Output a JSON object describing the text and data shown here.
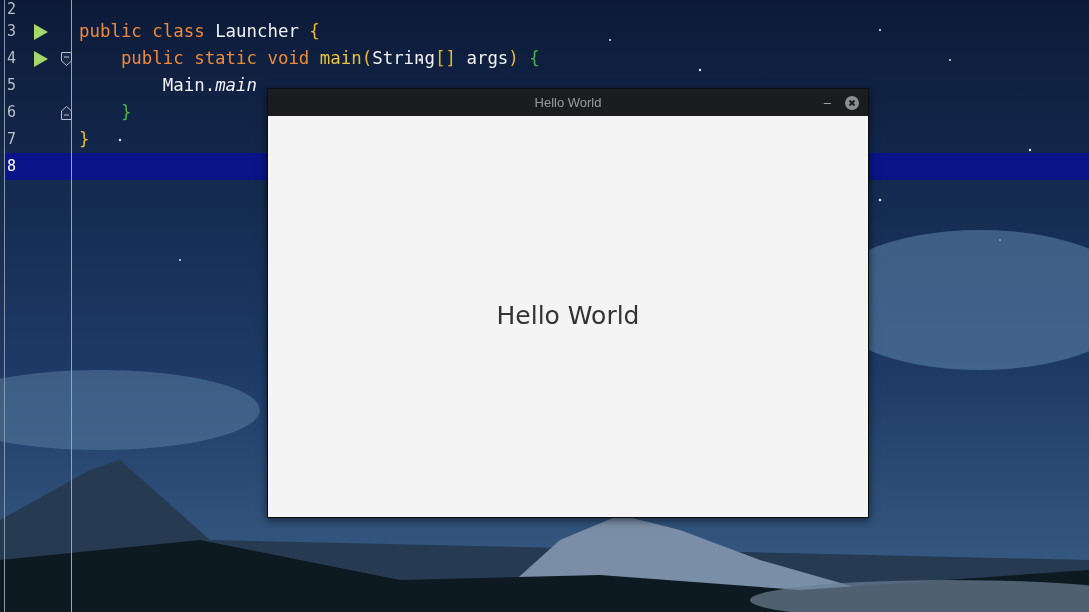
{
  "editor": {
    "lines": [
      {
        "number": "2",
        "current": false,
        "run": false,
        "fold_start": false,
        "fold_end": false
      },
      {
        "number": "3",
        "current": false,
        "run": true,
        "fold_start": false,
        "fold_end": false,
        "tokens": [
          {
            "text": "public class ",
            "kind": "keyword"
          },
          {
            "text": "Launcher ",
            "kind": "plain"
          },
          {
            "text": "{",
            "kind": "brace"
          }
        ]
      },
      {
        "number": "4",
        "current": false,
        "run": true,
        "fold_start": true,
        "fold_end": false,
        "tokens": [
          {
            "text": "    public static void ",
            "kind": "keyword"
          },
          {
            "text": "main",
            "kind": "method"
          },
          {
            "text": "(",
            "kind": "brace"
          },
          {
            "text": "String",
            "kind": "plain"
          },
          {
            "text": "[]",
            "kind": "brace"
          },
          {
            "text": " args",
            "kind": "plain"
          },
          {
            "text": ") ",
            "kind": "brace"
          },
          {
            "text": "{",
            "kind": "block"
          }
        ]
      },
      {
        "number": "5",
        "current": false,
        "run": false,
        "fold_start": false,
        "fold_end": false,
        "tokens": [
          {
            "text": "        Main.",
            "kind": "plain"
          },
          {
            "text": "main",
            "kind": "italic"
          }
        ]
      },
      {
        "number": "6",
        "current": false,
        "run": false,
        "fold_start": false,
        "fold_end": true,
        "tokens": [
          {
            "text": "    }",
            "kind": "block"
          }
        ]
      },
      {
        "number": "7",
        "current": false,
        "run": false,
        "fold_start": false,
        "fold_end": false,
        "tokens": [
          {
            "text": "}",
            "kind": "brace"
          }
        ]
      },
      {
        "number": "8",
        "current": true,
        "run": false,
        "fold_start": false,
        "fold_end": false
      }
    ]
  },
  "window": {
    "title": "Hello World",
    "minimize": "–",
    "label": "Hello World"
  }
}
